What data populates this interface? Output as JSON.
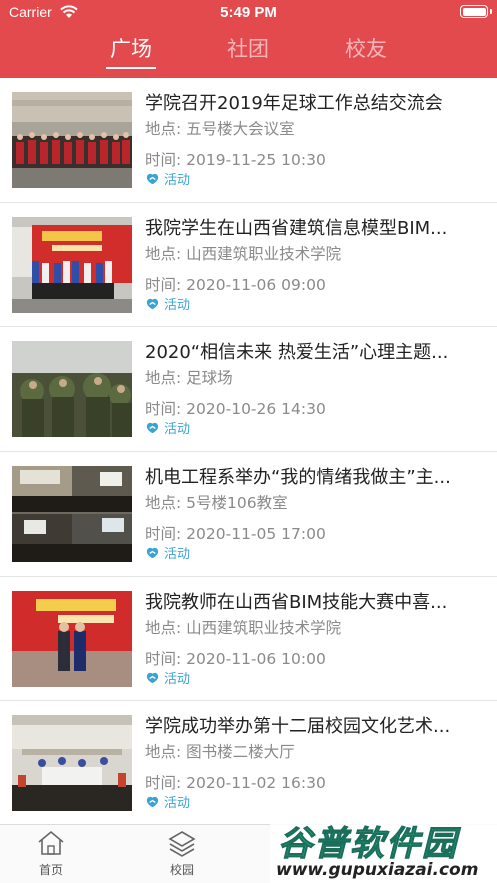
{
  "status_bar": {
    "carrier": "Carrier",
    "time": "5:49 PM"
  },
  "tabs": [
    {
      "label": "广场",
      "active": true
    },
    {
      "label": "社团",
      "active": false
    },
    {
      "label": "校友",
      "active": false
    }
  ],
  "list": [
    {
      "title": "学院召开2019年足球工作总结交流会",
      "location_label": "地点:",
      "location": "五号楼大会议室",
      "time_label": "时间:",
      "time": "2019-11-25 10:30",
      "tag": "活动"
    },
    {
      "title": "我院学生在山西省建筑信息模型BIM...",
      "location_label": "地点:",
      "location": "山西建筑职业技术学院",
      "time_label": "时间:",
      "time": "2020-11-06 09:00",
      "tag": "活动"
    },
    {
      "title": "2020“相信未来 热爱生活”心理主题...",
      "location_label": "地点:",
      "location": "足球场",
      "time_label": "时间:",
      "time": "2020-10-26 14:30",
      "tag": "活动"
    },
    {
      "title": "机电工程系举办“我的情绪我做主”主...",
      "location_label": "地点:",
      "location": "5号楼106教室",
      "time_label": "时间:",
      "time": "2020-11-05 17:00",
      "tag": "活动"
    },
    {
      "title": "我院教师在山西省BIM技能大赛中喜...",
      "location_label": "地点:",
      "location": "山西建筑职业技术学院",
      "time_label": "时间:",
      "time": "2020-11-06 10:00",
      "tag": "活动"
    },
    {
      "title": "学院成功举办第十二届校园文化艺术...",
      "location_label": "地点:",
      "location": "图书楼二楼大厅",
      "time_label": "时间:",
      "time": "2020-11-02 16:30",
      "tag": "活动"
    }
  ],
  "tabbar": [
    {
      "label": "首页",
      "icon": "home-icon"
    },
    {
      "label": "校园",
      "icon": "layers-icon"
    }
  ],
  "watermark": {
    "title": "谷普软件园",
    "url": "www.gupuxiazai.com"
  },
  "colors": {
    "header": "#e24a4e",
    "tag": "#3aa3d4",
    "muted": "#8a8a8a"
  }
}
